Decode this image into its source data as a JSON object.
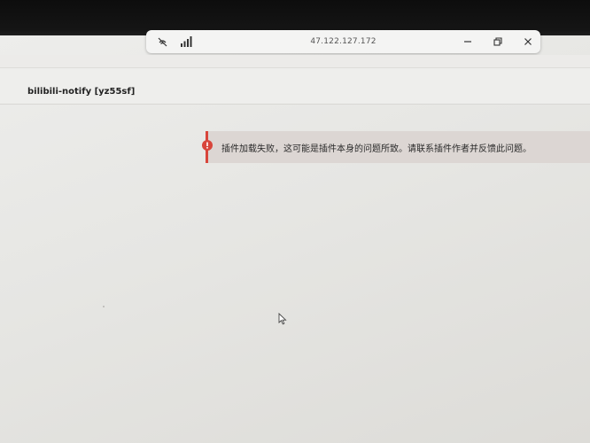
{
  "window": {
    "address": "47.122.127.172"
  },
  "icons": {
    "no_mic": "mic-off-icon",
    "signal": "signal-bars-icon",
    "minimize": "minimize-icon",
    "restore": "restore-icon",
    "close": "close-icon",
    "error": "error-icon",
    "cursor": "mouse-cursor-icon"
  },
  "plugin": {
    "title": "bilibili-notify [yz55sf]"
  },
  "alert": {
    "message": "插件加载失败，这可能是插件本身的问题所致。请联系插件作者并反馈此问题。",
    "accent_color": "#d8453b"
  }
}
